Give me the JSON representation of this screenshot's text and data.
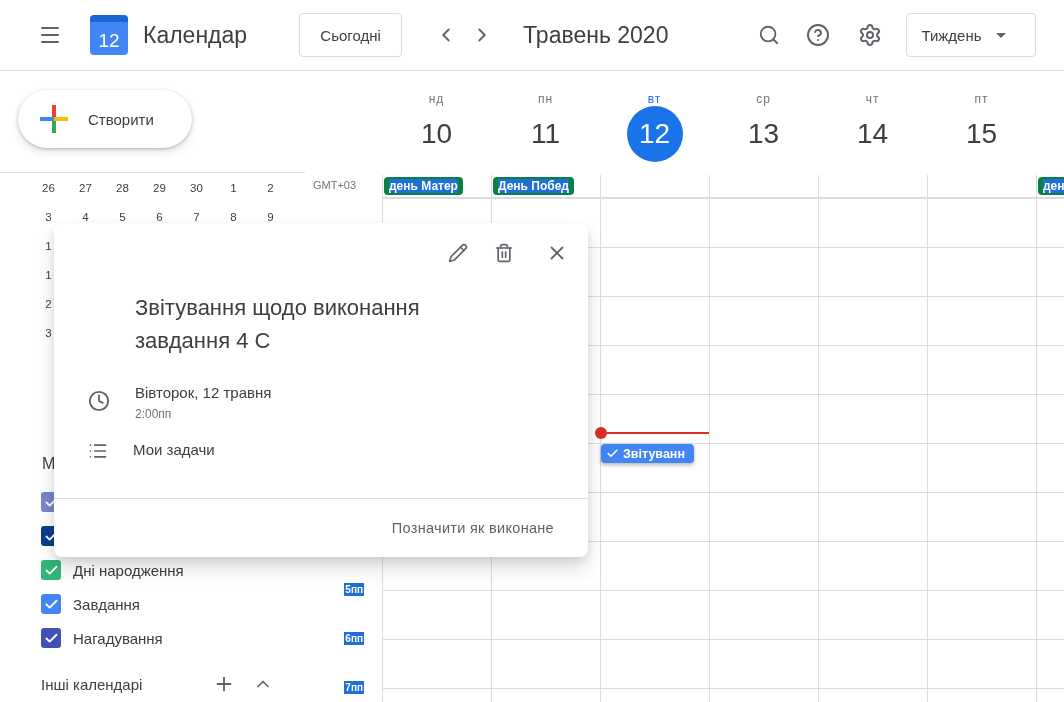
{
  "header": {
    "logo_day": "12",
    "title": "Календар",
    "today_button": "Сьогодні",
    "period": "Травень 2020",
    "view": "Тиждень"
  },
  "create_button": "Створити",
  "mini_calendar": [
    [
      "26",
      "27",
      "28",
      "29",
      "30",
      "1",
      "2"
    ],
    [
      "3",
      "4",
      "5",
      "6",
      "7",
      "8",
      "9"
    ],
    [
      "1"
    ],
    [
      "1"
    ],
    [
      "2"
    ],
    [
      "3"
    ]
  ],
  "my_calendars_heading": "М",
  "calendars": [
    {
      "color": "#7986cb",
      "checked": true
    },
    {
      "color": "#0b3d91",
      "checked": true
    },
    {
      "label": "Дні народження",
      "color": "#33b679",
      "checked": true
    },
    {
      "label": "Завдання",
      "color": "#4285f4",
      "checked": true
    },
    {
      "label": "Нагадування",
      "color": "#3f51b5",
      "checked": true
    }
  ],
  "other_calendars": "Інші календарі",
  "timezone": "GMT+03",
  "hour_labels": [
    "5пп",
    "6пп",
    "7пп"
  ],
  "days": [
    {
      "name": "нд",
      "date": "10",
      "selected": false,
      "all_day_event": "день Матер"
    },
    {
      "name": "пн",
      "date": "11",
      "selected": false,
      "all_day_event": "День Побед"
    },
    {
      "name": "вт",
      "date": "12",
      "selected": true,
      "now_line": true,
      "task": {
        "title": "Звітуванн",
        "done": true
      }
    },
    {
      "name": "ср",
      "date": "13",
      "selected": false
    },
    {
      "name": "чт",
      "date": "14",
      "selected": false
    },
    {
      "name": "пт",
      "date": "15",
      "selected": false
    }
  ],
  "next_day_all_day_event": "ден",
  "popup": {
    "title": "Звітування щодо виконання завдання 4 С",
    "date": "Вівторок, 12 травня",
    "time": "2:00пп",
    "list": "Мои задачи",
    "action": "Позначити як виконане"
  }
}
